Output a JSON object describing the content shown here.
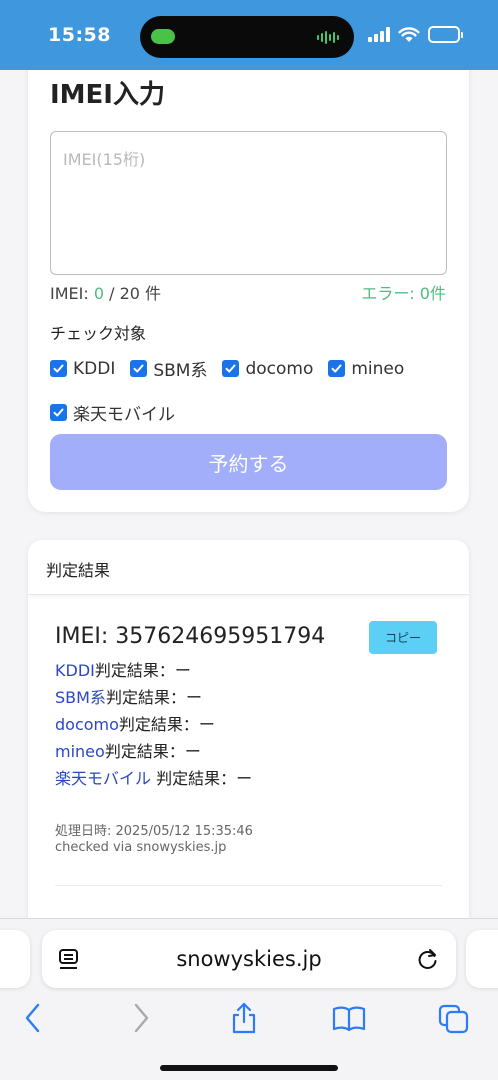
{
  "status_bar": {
    "time": "15:58"
  },
  "form": {
    "title": "IMEI入力",
    "imei_placeholder": "IMEI(15桁)",
    "imei_value": "",
    "counter_prefix": "IMEI: ",
    "counter_count": "0",
    "counter_suffix": " / 20 件",
    "error_label": "エラー: 0件",
    "check_title": "チェック対象",
    "checks": [
      {
        "label": "KDDI",
        "checked": true
      },
      {
        "label": "SBM系",
        "checked": true
      },
      {
        "label": "docomo",
        "checked": true
      },
      {
        "label": "mineo",
        "checked": true
      },
      {
        "label": "楽天モバイル",
        "checked": true
      }
    ],
    "submit_label": "予約する",
    "accent_color": "#1a73e8",
    "submit_color": "#a3aefb"
  },
  "result": {
    "header": "判定結果",
    "imei_line": "IMEI: 357624695951794",
    "copy_label": "コピー",
    "lines": [
      {
        "carrier": "KDDI",
        "suffix": "判定結果：ー"
      },
      {
        "carrier": "SBM系",
        "suffix": "判定結果：ー"
      },
      {
        "carrier": "docomo",
        "suffix": "判定結果：ー"
      },
      {
        "carrier": "mineo",
        "suffix": "判定結果：ー"
      },
      {
        "carrier": "楽天モバイル",
        "suffix": " 判定結果：ー"
      }
    ],
    "processed_at": "処理日時: 2025/05/12 15:35:46",
    "checked_via": "checked via snowyskies.jp"
  },
  "browser": {
    "url": "snowyskies.jp",
    "icons": [
      "reader-icon",
      "reload-icon",
      "back-icon",
      "forward-icon",
      "share-icon",
      "bookmarks-icon",
      "tabs-icon"
    ]
  }
}
